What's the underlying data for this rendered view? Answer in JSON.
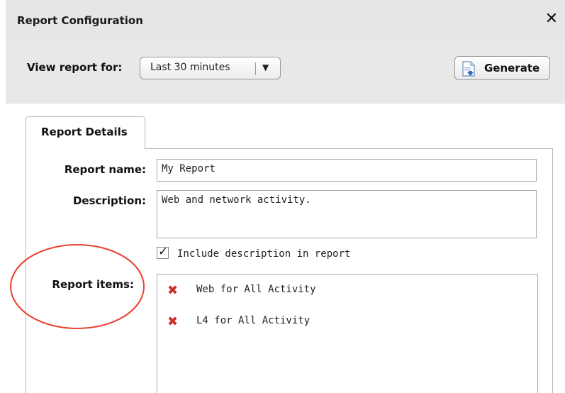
{
  "dialog": {
    "title": "Report Configuration",
    "close_glyph": "✕"
  },
  "toolbar": {
    "view_label": "View report for:",
    "time_range": {
      "selected": "Last 30 minutes",
      "arrow": "▼"
    },
    "generate_label": "Generate"
  },
  "tabs": [
    {
      "label": "Report Details",
      "active": true
    }
  ],
  "form": {
    "report_name": {
      "label": "Report name:",
      "value": "My Report"
    },
    "description": {
      "label": "Description:",
      "value": "Web and network activity."
    },
    "include_description": {
      "label": "Include description in report",
      "checked": true,
      "mark": "✓"
    },
    "report_items": {
      "label": "Report items:",
      "remove_glyph": "✖",
      "items": [
        "Web for All Activity",
        "L4 for All Activity"
      ]
    }
  },
  "colors": {
    "remove_icon": "#c8302c",
    "highlight_circle": "#e8412c"
  },
  "icons": [
    "close-icon",
    "dropdown-arrow-icon",
    "generate-document-icon",
    "checkmark-icon",
    "remove-icon"
  ]
}
